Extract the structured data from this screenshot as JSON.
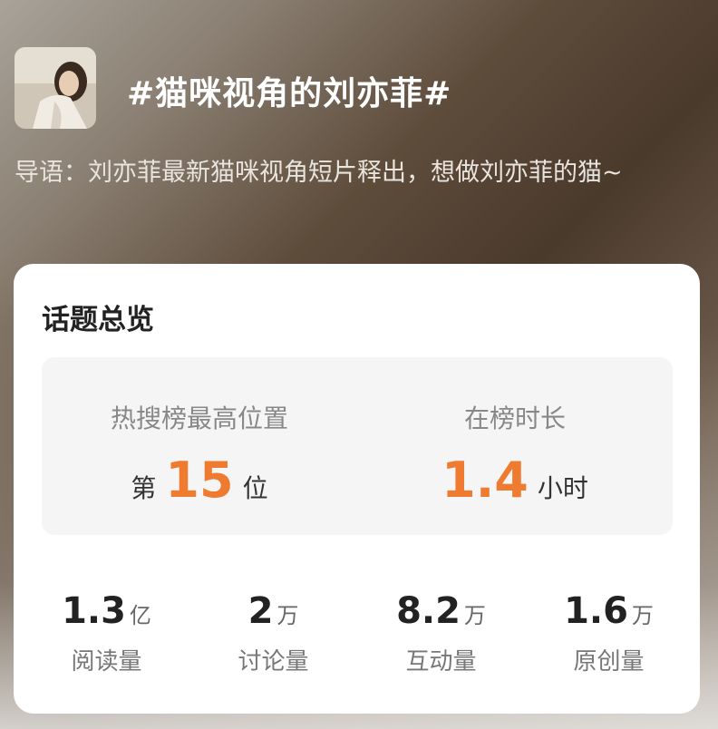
{
  "topic": {
    "title": "#猫咪视角的刘亦菲#",
    "avatar_icon": "user-photo-avatar",
    "intro": "导语：刘亦菲最新猫咪视角短片释出，想做刘亦菲的猫~"
  },
  "overview": {
    "title": "话题总览",
    "highest_rank": {
      "label": "热搜榜最高位置",
      "prefix": "第",
      "value": "15",
      "suffix": "位"
    },
    "duration": {
      "label": "在榜时长",
      "value": "1.4",
      "suffix": "小时"
    },
    "accent_color": "#ee7b2f",
    "stats": [
      {
        "value": "1.3",
        "unit": "亿",
        "label": "阅读量"
      },
      {
        "value": "2",
        "unit": "万",
        "label": "讨论量"
      },
      {
        "value": "8.2",
        "unit": "万",
        "label": "互动量"
      },
      {
        "value": "1.6",
        "unit": "万",
        "label": "原创量"
      }
    ]
  }
}
